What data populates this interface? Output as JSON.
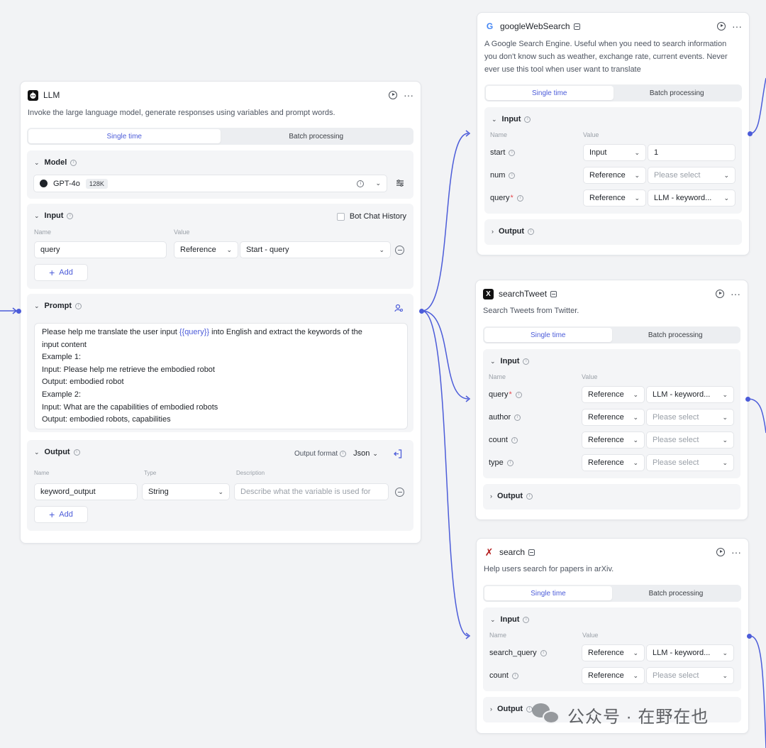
{
  "colors": {
    "accent": "#4c5cd9",
    "canvas": "#f2f3f5",
    "wire": "#4c5cd9"
  },
  "llm_node": {
    "title": "LLM",
    "icon": "llm-robot-icon",
    "description": "Invoke the large language model, generate responses using variables and prompt words.",
    "tabs": [
      "Single time",
      "Batch processing"
    ],
    "model": {
      "label": "Model",
      "name": "GPT-4o",
      "context": "128K"
    },
    "input": {
      "label": "Input",
      "bot_chat_history": "Bot Chat History",
      "col_name": "Name",
      "col_value": "Value",
      "row": {
        "name": "query",
        "mode": "Reference",
        "value": "Start - query"
      },
      "add": "Add"
    },
    "prompt": {
      "label": "Prompt",
      "line1_a": "Please help me translate the user input ",
      "line1_var": "{{query}}",
      "line1_b": " into English and extract the keywords of the",
      "lines": [
        "input content",
        "Example 1:",
        "Input: Please help me retrieve the embodied robot",
        "Output: embodied robot",
        "Example 2:",
        "Input: What are the capabilities of embodied robots",
        "Output: embodied robots, capabilities"
      ]
    },
    "output": {
      "label": "Output",
      "format_label": "Output format",
      "format_value": "Json",
      "col_name": "Name",
      "col_type": "Type",
      "col_desc": "Description",
      "row": {
        "name": "keyword_output",
        "type": "String",
        "desc_placeholder": "Describe what the variable is used for"
      },
      "add": "Add"
    }
  },
  "google_node": {
    "title": "googleWebSearch",
    "icon": "google-icon",
    "description": "A Google Search Engine. Useful when you need to search information you don't know such as weather, exchange rate, current events. Never ever use this tool when user want to translate",
    "tabs": [
      "Single time",
      "Batch processing"
    ],
    "input_label": "Input",
    "col_name": "Name",
    "col_value": "Value",
    "params": [
      {
        "name": "start",
        "required": false,
        "mode": "Input",
        "value": "1",
        "placeholder": false
      },
      {
        "name": "num",
        "required": false,
        "mode": "Reference",
        "value": "Please select",
        "placeholder": true
      },
      {
        "name": "query",
        "required": true,
        "mode": "Reference",
        "value": "LLM - keyword...",
        "placeholder": false
      }
    ],
    "output_label": "Output"
  },
  "tweet_node": {
    "title": "searchTweet",
    "icon": "x-logo-icon",
    "description": "Search Tweets from Twitter.",
    "tabs": [
      "Single time",
      "Batch processing"
    ],
    "input_label": "Input",
    "col_name": "Name",
    "col_value": "Value",
    "params": [
      {
        "name": "query",
        "required": true,
        "mode": "Reference",
        "value": "LLM - keyword...",
        "placeholder": false
      },
      {
        "name": "author",
        "required": false,
        "mode": "Reference",
        "value": "Please select",
        "placeholder": true
      },
      {
        "name": "count",
        "required": false,
        "mode": "Reference",
        "value": "Please select",
        "placeholder": true
      },
      {
        "name": "type",
        "required": false,
        "mode": "Reference",
        "value": "Please select",
        "placeholder": true
      }
    ],
    "output_label": "Output"
  },
  "arxiv_node": {
    "title": "search",
    "icon": "arxiv-icon",
    "description": "Help users search for papers in arXiv.",
    "tabs": [
      "Single time",
      "Batch processing"
    ],
    "input_label": "Input",
    "col_name": "Name",
    "col_value": "Value",
    "params": [
      {
        "name": "search_query",
        "required": false,
        "mode": "Reference",
        "value": "LLM - keyword...",
        "placeholder": false
      },
      {
        "name": "count",
        "required": false,
        "mode": "Reference",
        "value": "Please select",
        "placeholder": true
      }
    ],
    "output_label": "Output"
  },
  "watermark": {
    "text": "公众号 · 在野在也",
    "icon": "wechat-icon"
  }
}
